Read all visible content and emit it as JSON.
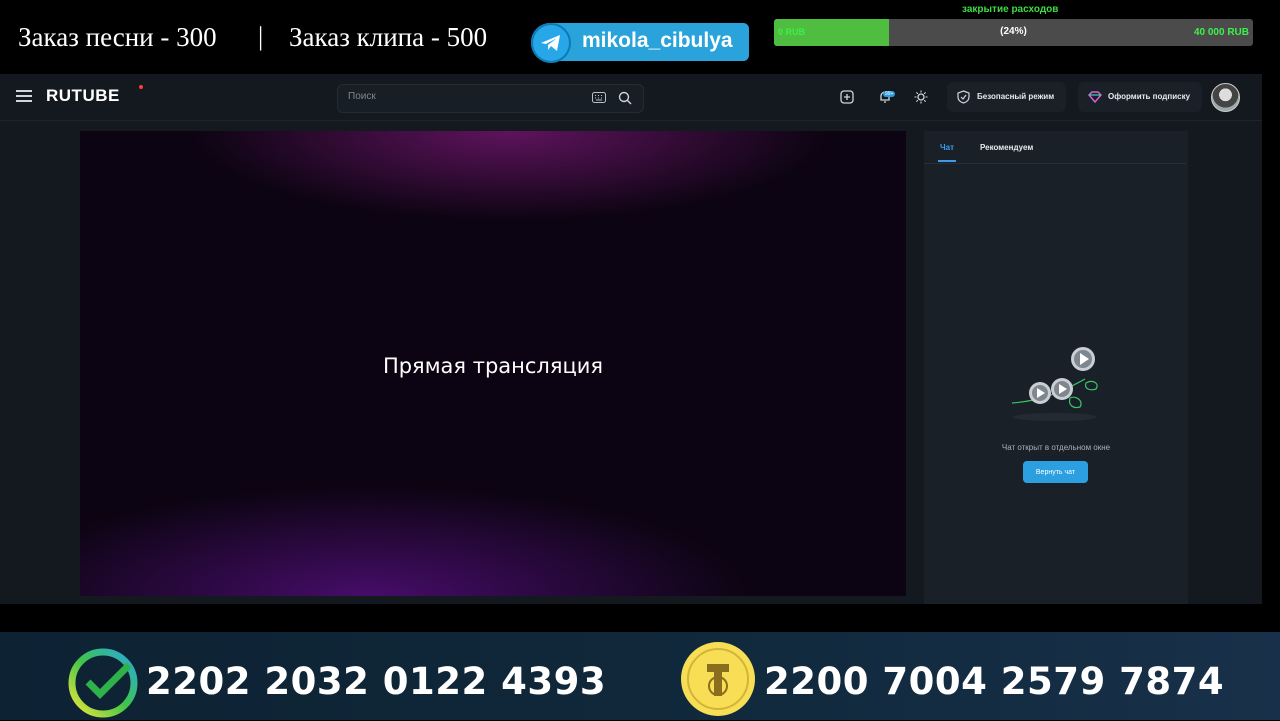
{
  "overlay": {
    "promo_song": "Заказ песни - 300",
    "separator": "|",
    "promo_clip": "Заказ клипа - 500",
    "telegram_handle": "mikola_cibulya",
    "goal": {
      "title": "закрытие расходов",
      "start_label": "0 RUB",
      "percent_label": "(24%)",
      "end_label": "40 000 RUB",
      "progress_fraction": 0.24,
      "fill_color": "#4fbd3f"
    }
  },
  "rutube": {
    "logo": "RUTUBE",
    "search_placeholder": "Поиск",
    "notifications_badge": "99+",
    "safe_mode_label": "Безопасный режим",
    "subscribe_label": "Оформить подписку",
    "player_text": "Прямая трансляция",
    "chat": {
      "tab_chat": "Чат",
      "tab_recommended": "Рекомендуем",
      "message": "Чат открыт в отдельном окне",
      "return_button": "Вернуть чат"
    }
  },
  "payments": {
    "card1": "2202 2032 0122 4393",
    "card2": "2200 7004 2579 7874"
  },
  "icons": {
    "telegram": "telegram-icon",
    "menu": "hamburger-menu-icon",
    "keyboard": "keyboard-icon",
    "search": "search-icon",
    "add": "add-video-icon",
    "notifications": "bell-icon",
    "theme": "sun-icon",
    "shield": "shield-icon",
    "diamond": "diamond-icon",
    "sber": "sber-logo-icon",
    "tinkoff": "tinkoff-logo-icon"
  },
  "colors": {
    "accent_blue": "#2b9fe0",
    "rutube_red": "#ff3b3b",
    "goal_green": "#3ddc45"
  }
}
